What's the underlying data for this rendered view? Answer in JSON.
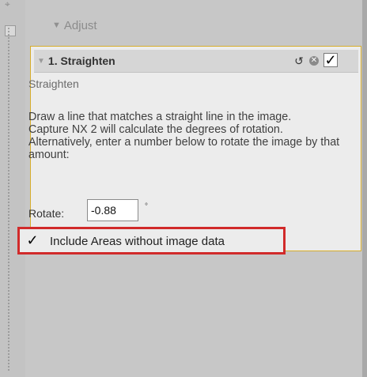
{
  "adjust": {
    "title": "Adjust"
  },
  "step": {
    "title": "1. Straighten",
    "name": "Straighten",
    "instructions": "Draw a line that matches a straight line in the image.\nCapture NX 2 will calculate the degrees of rotation.\nAlternatively, enter a number below to rotate the image by that amount:",
    "rotate_label": "Rotate:",
    "rotate_value": "-0.88",
    "unit": "°",
    "include_label": "Include Areas without image data",
    "include_checked": "✓",
    "apply_checked": "✓",
    "reset_icon": "↺",
    "delete_icon": "✕"
  },
  "colors": {
    "panel_border": "#d7ad2b",
    "highlight": "#d12a2a"
  }
}
